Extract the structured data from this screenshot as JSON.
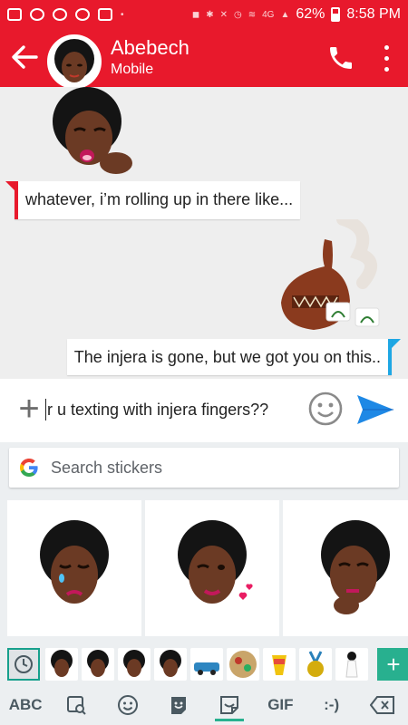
{
  "status_bar": {
    "battery": "62%",
    "time": "8:58 PM",
    "network": "4G"
  },
  "header": {
    "contact_name": "Abebech",
    "contact_subtitle": "Mobile"
  },
  "messages": [
    {
      "direction": "incoming",
      "text": "whatever, i’m rolling up in there like..."
    },
    {
      "direction": "outgoing",
      "text": "The injera is gone, but we got you on this.."
    }
  ],
  "compose": {
    "text": "r u texting with injera fingers??"
  },
  "keyboard": {
    "search_placeholder": "Search stickers",
    "bottom_keys": [
      "ABC",
      "GIF",
      ":-)"
    ]
  },
  "colors": {
    "brand": "#e8192c",
    "outgoing_accent": "#1ea7e4",
    "keyboard_accent": "#28b08f",
    "send": "#1e88e5"
  }
}
